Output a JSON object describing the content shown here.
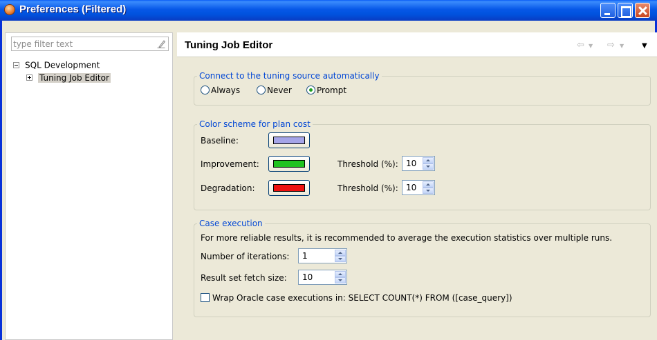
{
  "window": {
    "title": "Preferences (Filtered)"
  },
  "filter": {
    "placeholder": "type filter text"
  },
  "tree": {
    "root": "SQL Development",
    "child": "Tuning Job Editor"
  },
  "page": {
    "title": "Tuning Job Editor"
  },
  "connect_group": {
    "legend": "Connect to the tuning source automatically",
    "options": [
      {
        "label": "Always",
        "selected": false
      },
      {
        "label": "Never",
        "selected": false
      },
      {
        "label": "Prompt",
        "selected": true
      }
    ]
  },
  "color_group": {
    "legend": "Color scheme for plan cost",
    "baseline_label": "Baseline:",
    "improvement_label": "Improvement:",
    "degradation_label": "Degradation:",
    "threshold_label": "Threshold (%):",
    "improvement_threshold": "10",
    "degradation_threshold": "10",
    "colors": {
      "baseline": "#a4a4e8",
      "improvement": "#1fc21f",
      "degradation": "#ee1111"
    }
  },
  "case_group": {
    "legend": "Case execution",
    "description": "For more reliable results, it is recommended to average the execution statistics over multiple runs.",
    "iterations_label": "Number of iterations:",
    "iterations_value": "1",
    "fetch_label": "Result set fetch size:",
    "fetch_value": "10",
    "wrap_label": "Wrap Oracle case executions in: SELECT COUNT(*) FROM ([case_query])",
    "wrap_checked": false
  },
  "icons": [
    "app-icon",
    "eraser-icon",
    "back-arrow-icon",
    "forward-arrow-icon",
    "view-menu-icon"
  ]
}
